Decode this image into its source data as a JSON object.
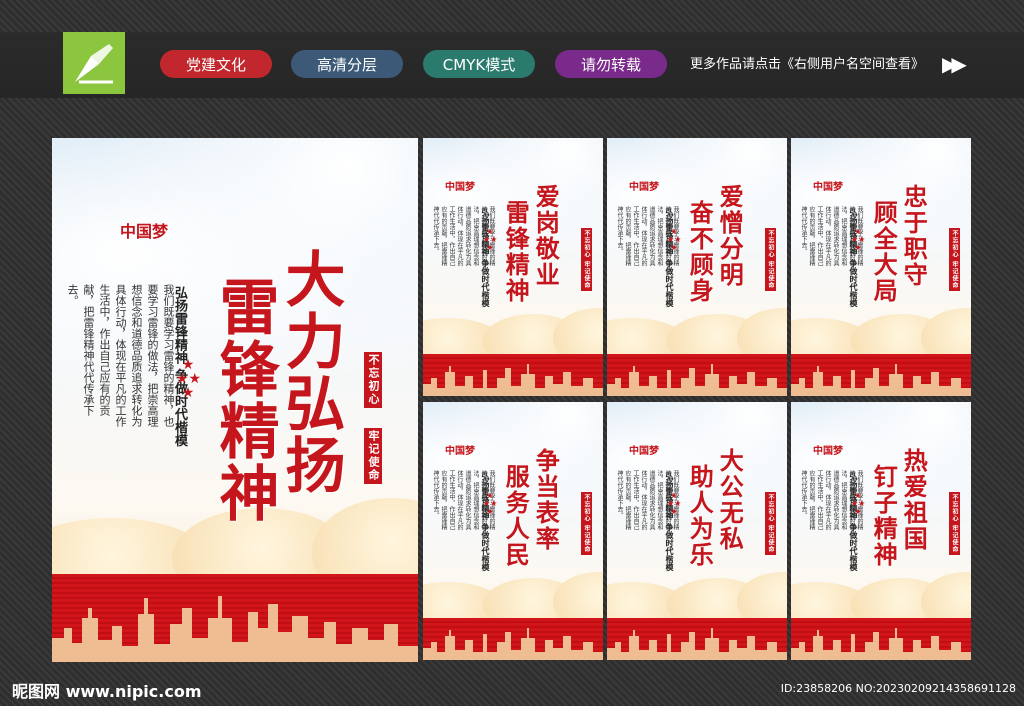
{
  "header": {
    "tags": [
      {
        "label": "党建文化",
        "color": "#c1272d"
      },
      {
        "label": "高清分层",
        "color": "#3c5a78"
      },
      {
        "label": "CMYK模式",
        "color": "#2a7a6e"
      },
      {
        "label": "请勿转载",
        "color": "#7a2a8a"
      }
    ],
    "notice": "更多作品请点击《右侧用户名空间查看》",
    "arrows": "▶▶"
  },
  "main_poster": {
    "title_1": "大力弘扬",
    "title_2": "雷锋精神",
    "subtitle": "弘扬雷锋精神 争做时代楷模",
    "body": "我们既要学习雷锋的精神，也要学习雷锋的做法，把崇高理想信念和道德品质追求转化为具体行动，体现在平凡的工作生活中，作出自己应有的贡献，把雷锋精神代代传承下去。",
    "seal_1": "不忘初心",
    "seal_2": "牢记使命",
    "emblem": "中国梦"
  },
  "small_posters": [
    {
      "title_1": "爱岗敬业",
      "title_2": "雷锋精神"
    },
    {
      "title_1": "爱憎分明",
      "title_2": "奋不顾身"
    },
    {
      "title_1": "忠于职守",
      "title_2": "顾全大局"
    },
    {
      "title_1": "争当表率",
      "title_2": "服务人民"
    },
    {
      "title_1": "大公无私",
      "title_2": "助人为乐"
    },
    {
      "title_1": "热爱祖国",
      "title_2": "钉子精神"
    }
  ],
  "small_common": {
    "subtitle": "弘扬雷锋精神 争做时代楷模",
    "body": "我们既要学习雷锋的精神，也要学习雷锋的做法，把崇高理想信念和道德品质追求转化为具体行动，体现在平凡的工作生活中，作出自己应有的贡献，把雷锋精神代代传承下去。",
    "seal": "不忘初心 牢记使命",
    "emblem": "中国梦"
  },
  "footer": {
    "site": "昵图网 www.nipic.com",
    "id": "ID:23858206 NO:20230209214358691128"
  }
}
